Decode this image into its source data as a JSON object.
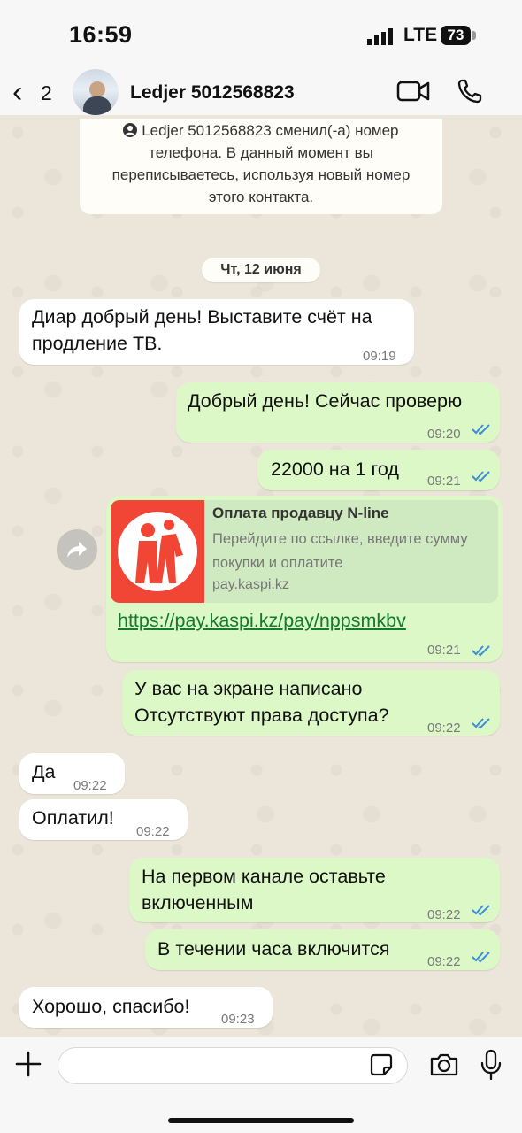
{
  "status": {
    "time": "16:59",
    "network": "LTE",
    "battery": "73"
  },
  "header": {
    "back_count": "2",
    "contact_name": "Ledjer 5012568823"
  },
  "notice": {
    "text": "Ledjer 5012568823 сменил(-а) номер телефона. В данный момент вы переписываетесь, используя новый номер этого контакта."
  },
  "date_label": "Чт, 12 июня",
  "messages": [
    {
      "dir": "in",
      "lines": [
        "Диар добрый день! Выставите счёт на",
        "продление ТВ."
      ],
      "time": "09:19"
    },
    {
      "dir": "out",
      "lines": [
        "Добрый день! Сейчас проверю"
      ],
      "time": "09:20"
    },
    {
      "dir": "out",
      "lines": [
        "22000 на 1 год"
      ],
      "time": "09:21"
    },
    {
      "dir": "out",
      "link": "https://pay.kaspi.kz/pay/nppsmkbv",
      "time": "09:21"
    },
    {
      "dir": "out",
      "lines": [
        "У вас на экране написано",
        "Отсутствуют права доступа?"
      ],
      "time": "09:22"
    },
    {
      "dir": "in",
      "lines": [
        "Да"
      ],
      "time": "09:22"
    },
    {
      "dir": "in",
      "lines": [
        "Оплатил!"
      ],
      "time": "09:22"
    },
    {
      "dir": "out",
      "lines": [
        "На первом канале оставьте",
        "включенным"
      ],
      "time": "09:22"
    },
    {
      "dir": "out",
      "lines": [
        "В течении часа включится"
      ],
      "time": "09:22"
    },
    {
      "dir": "in",
      "lines": [
        "Хорошо, спасибо!"
      ],
      "time": "09:23"
    }
  ],
  "link_preview": {
    "title": "Оплата продавцу N-line",
    "description": "Перейдите по ссылке, введите сумму покупки и оплатите",
    "domain": "pay.kaspi.kz"
  },
  "colors": {
    "outgoing_bubble": "#dcf8c6",
    "incoming_bubble": "#ffffff",
    "read_check": "#3b8fd8",
    "link": "#127b2c"
  },
  "icons": [
    "back-chevron-icon",
    "video-call-icon",
    "phone-icon",
    "forward-icon",
    "plus-icon",
    "sticker-icon",
    "camera-icon",
    "mic-icon",
    "read-check-icon",
    "contact-icon"
  ]
}
